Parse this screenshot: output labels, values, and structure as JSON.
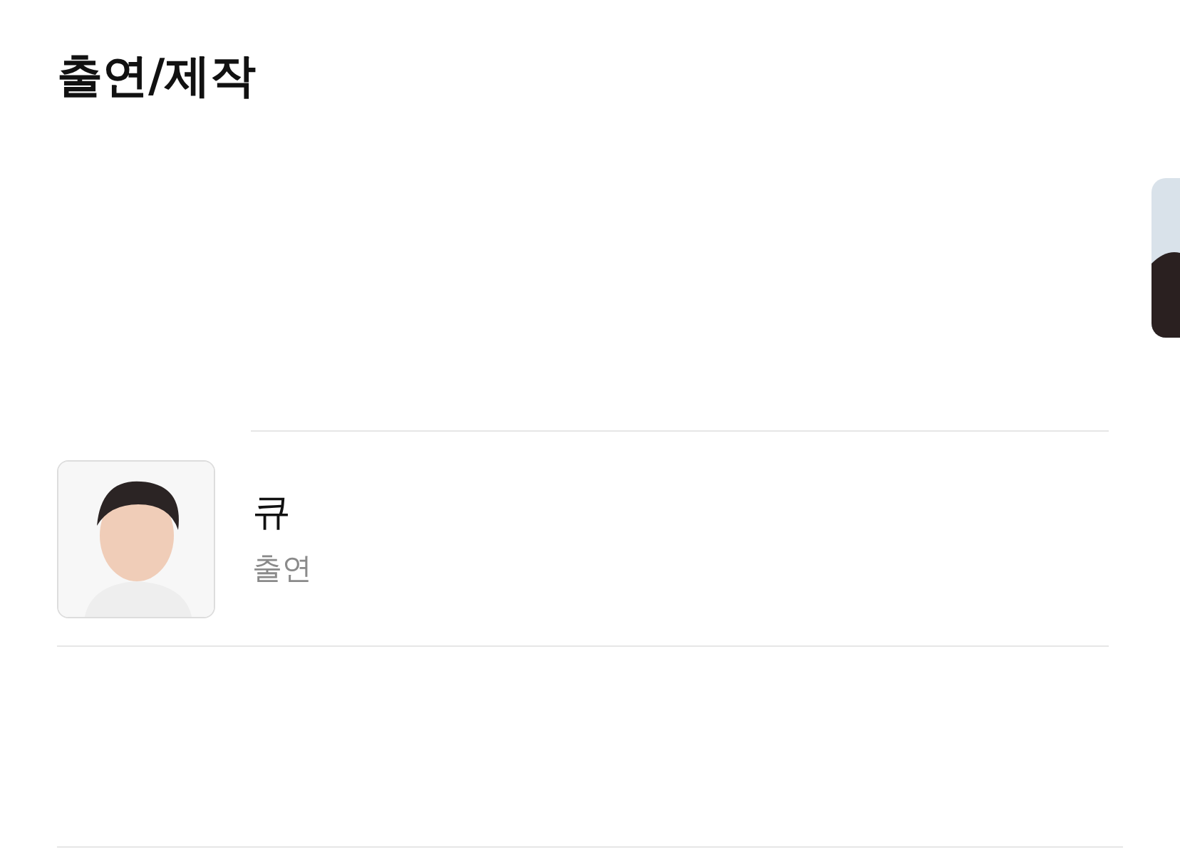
{
  "title": "출연/제작",
  "cast": [
    {
      "name": "큐",
      "role": "출연"
    }
  ]
}
